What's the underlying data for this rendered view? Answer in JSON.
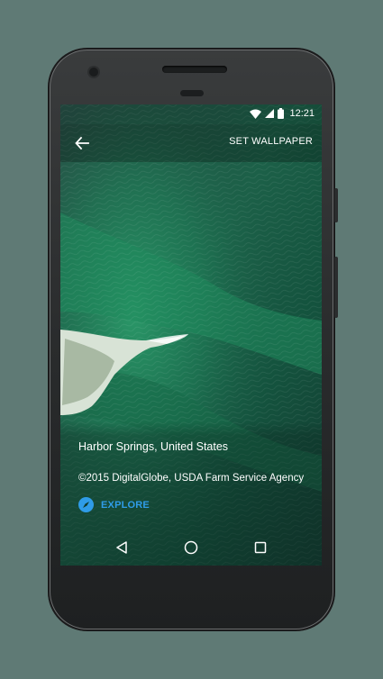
{
  "status_bar": {
    "time": "12:21",
    "icons": [
      "wifi-icon",
      "signal-icon",
      "battery-icon"
    ]
  },
  "toolbar": {
    "back_icon": "arrow-back-icon",
    "set_wallpaper_label": "SET WALLPAPER"
  },
  "wallpaper": {
    "location": "Harbor Springs, United States",
    "attribution": "©2015 DigitalGlobe, USDA Farm Service Agency",
    "explore_label": "EXPLORE",
    "explore_icon": "compass-icon"
  },
  "nav_bar": {
    "buttons": [
      "back-triangle-icon",
      "home-circle-icon",
      "recents-square-icon"
    ]
  },
  "colors": {
    "background": "#5f7a75",
    "accent": "#2f9ce8",
    "water": "#1d4a3b"
  }
}
